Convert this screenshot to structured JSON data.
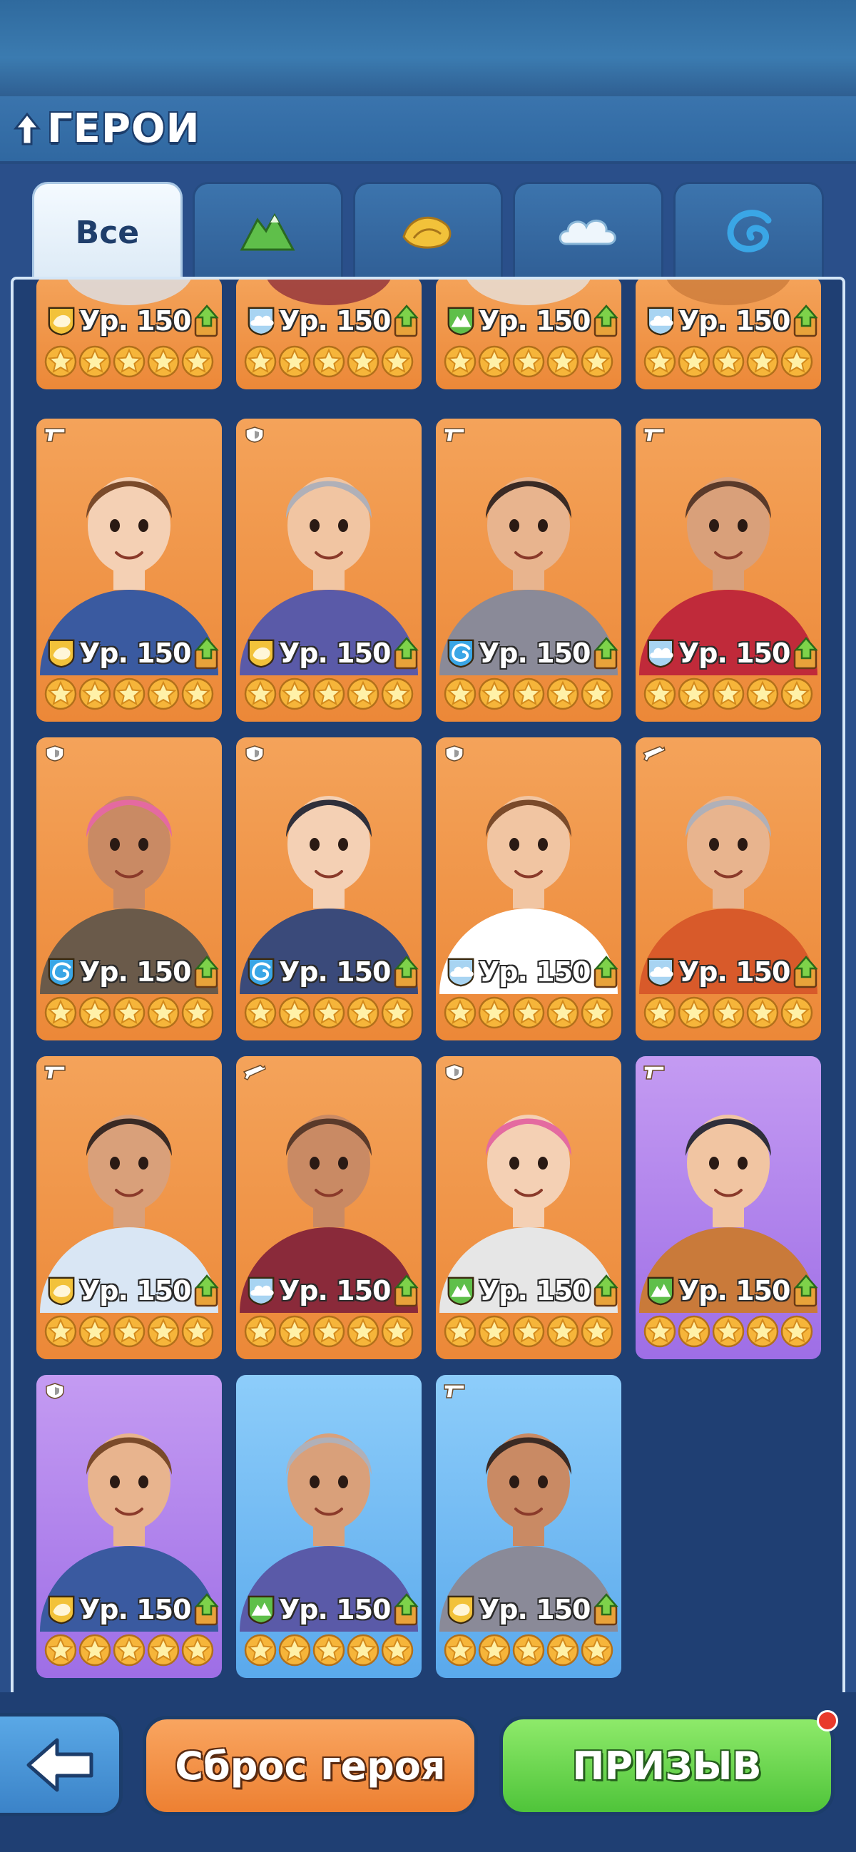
{
  "header": {
    "title": "ГЕРОИ"
  },
  "tabs": {
    "all_label": "Все",
    "items": [
      {
        "name": "all",
        "active": true
      },
      {
        "name": "mountain",
        "icon": "mountain-icon",
        "color": "#5fbf4a"
      },
      {
        "name": "desert",
        "icon": "dune-icon",
        "color": "#f2c23a"
      },
      {
        "name": "cloud",
        "icon": "cloud-icon",
        "color": "#e6f2fb"
      },
      {
        "name": "ocean",
        "icon": "wave-icon",
        "color": "#3aa6e6"
      }
    ]
  },
  "level_text": "Ур. 150",
  "faction_colors": {
    "desert": "#f2c23a",
    "cloud": "#a8d4f2",
    "mountain": "#5fbf4a",
    "ocean": "#3aa6e6"
  },
  "heroes": [
    {
      "faction": "desert",
      "weapon": "none",
      "rarity": "orange",
      "level": "Ур. 150",
      "stars": 5,
      "partial": true
    },
    {
      "faction": "cloud",
      "weapon": "none",
      "rarity": "orange",
      "level": "Ур. 150",
      "stars": 5,
      "partial": true
    },
    {
      "faction": "mountain",
      "weapon": "none",
      "rarity": "orange",
      "level": "Ур. 150",
      "stars": 5,
      "partial": true
    },
    {
      "faction": "cloud",
      "weapon": "none",
      "rarity": "orange",
      "level": "Ур. 150",
      "stars": 5,
      "partial": true
    },
    {
      "faction": "desert",
      "weapon": "pistol",
      "rarity": "orange",
      "level": "Ур. 150",
      "stars": 5
    },
    {
      "faction": "desert",
      "weapon": "shield",
      "rarity": "orange",
      "level": "Ур. 150",
      "stars": 5
    },
    {
      "faction": "ocean",
      "weapon": "pistol",
      "rarity": "orange",
      "level": "Ур. 150",
      "stars": 5
    },
    {
      "faction": "cloud",
      "weapon": "pistol",
      "rarity": "orange",
      "level": "Ур. 150",
      "stars": 5
    },
    {
      "faction": "ocean",
      "weapon": "shield",
      "rarity": "orange",
      "level": "Ур. 150",
      "stars": 5
    },
    {
      "faction": "ocean",
      "weapon": "shield",
      "rarity": "orange",
      "level": "Ур. 150",
      "stars": 5
    },
    {
      "faction": "cloud",
      "weapon": "shield",
      "rarity": "orange",
      "level": "Ур. 150",
      "stars": 5
    },
    {
      "faction": "cloud",
      "weapon": "rifle",
      "rarity": "orange",
      "level": "Ур. 150",
      "stars": 5
    },
    {
      "faction": "desert",
      "weapon": "pistol",
      "rarity": "orange",
      "level": "Ур. 150",
      "stars": 5
    },
    {
      "faction": "cloud",
      "weapon": "rifle",
      "rarity": "orange",
      "level": "Ур. 150",
      "stars": 5
    },
    {
      "faction": "mountain",
      "weapon": "shield",
      "rarity": "orange",
      "level": "Ур. 150",
      "stars": 5
    },
    {
      "faction": "mountain",
      "weapon": "pistol",
      "rarity": "purple",
      "level": "Ур. 150",
      "stars": 5
    },
    {
      "faction": "desert",
      "weapon": "shield",
      "rarity": "purple",
      "level": "Ур. 150",
      "stars": 5
    },
    {
      "faction": "mountain",
      "weapon": "none",
      "rarity": "blue",
      "level": "Ур. 150",
      "stars": 5
    },
    {
      "faction": "desert",
      "weapon": "pistol",
      "rarity": "blue",
      "level": "Ур. 150",
      "stars": 5
    }
  ],
  "buttons": {
    "back_icon": "back-arrow-icon",
    "reset_label": "Сброс героя",
    "summon_label": "ПРИЗЫВ"
  }
}
